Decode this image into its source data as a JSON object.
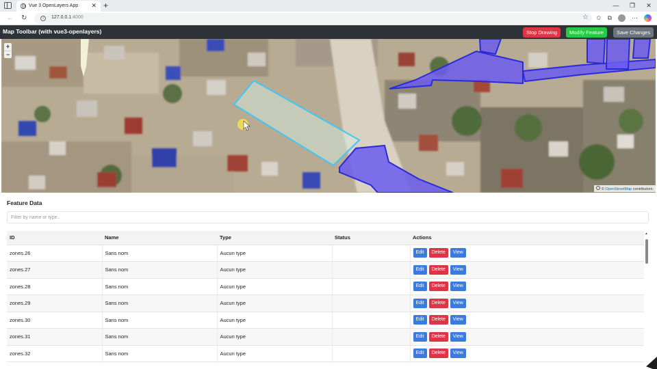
{
  "browser": {
    "tab_title": "Vue 3 OpenLayers App",
    "url_host": "127.0.0.1",
    "url_port": ":4000"
  },
  "toolbar": {
    "title": "Map Toolbar (with vue3-openlayers)",
    "stop_drawing_label": "Stop Drawing",
    "modify_feature_label": "Modify Feature",
    "save_changes_label": "Save Changes"
  },
  "map": {
    "zoom_in": "+",
    "zoom_out": "−",
    "attribution_prefix": "©",
    "attribution_link": "OpenStreetMap",
    "attribution_suffix": "contributors."
  },
  "feature_data": {
    "title": "Feature Data",
    "filter_placeholder": "Filter by name or type..",
    "columns": [
      "ID",
      "Name",
      "Type",
      "Status",
      "Actions"
    ],
    "action_labels": {
      "edit": "Edit",
      "delete": "Delete",
      "view": "View"
    },
    "rows": [
      {
        "id": "zones.26",
        "name": "Sans nom",
        "type": "Aucun type",
        "status": ""
      },
      {
        "id": "zones.27",
        "name": "Sans nom",
        "type": "Aucun type",
        "status": ""
      },
      {
        "id": "zones.28",
        "name": "Sans nom",
        "type": "Aucun type",
        "status": ""
      },
      {
        "id": "zones.29",
        "name": "Sans nom",
        "type": "Aucun type",
        "status": ""
      },
      {
        "id": "zones.30",
        "name": "Sans nom",
        "type": "Aucun type",
        "status": ""
      },
      {
        "id": "zones.31",
        "name": "Sans nom",
        "type": "Aucun type",
        "status": ""
      },
      {
        "id": "zones.32",
        "name": "Sans nom",
        "type": "Aucun type",
        "status": ""
      }
    ]
  },
  "colors": {
    "toolbar_bg": "#2d3338",
    "danger": "#dc3545",
    "success": "#28c745",
    "secondary": "#6c757d",
    "primary": "#3a7bdc",
    "polygon_fill": "#6b5cf0",
    "drawing_stroke": "#3ec7f5"
  }
}
